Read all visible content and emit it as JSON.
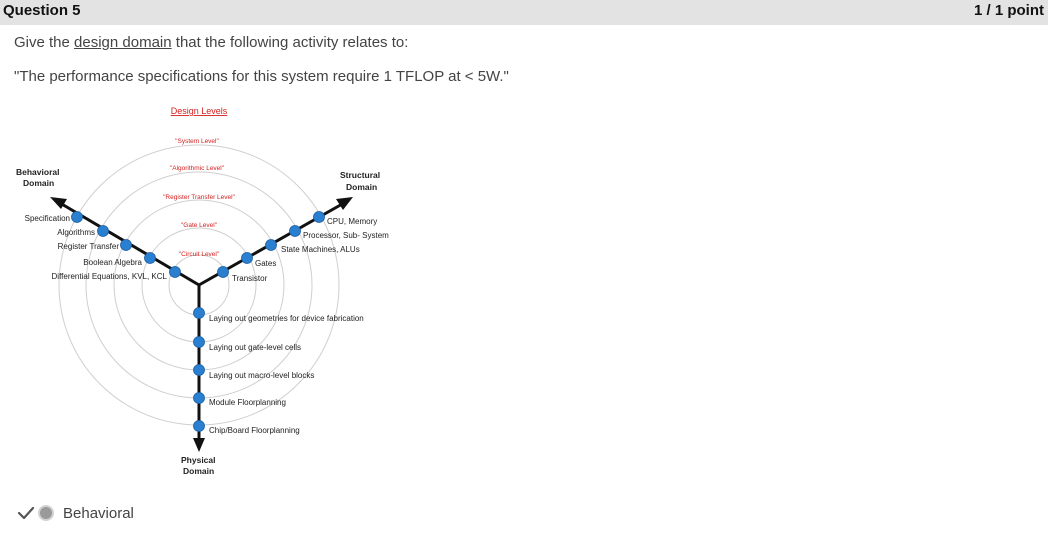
{
  "question": {
    "title": "Question 5",
    "score": "1 / 1 point",
    "prompt_before": "Give the ",
    "prompt_link": "design domain",
    "prompt_after": " that the following activity relates to:",
    "statement": "\"The performance specifications for this system require 1 TFLOP at < 5W.\""
  },
  "diagram": {
    "title": "Design Levels",
    "levels": [
      "\"System Level\"",
      "\"Algorithmic Level\"",
      "\"Register Transfer Level\"",
      "\"Gate Level\"",
      "\"Circuit Level\""
    ],
    "behavioral_domain": [
      "Behavioral",
      "Domain"
    ],
    "structural_domain": [
      "Structural",
      "Domain"
    ],
    "physical_domain": [
      "Physical",
      "Domain"
    ],
    "behavioral_items": [
      "Specification",
      "Algorithms",
      "Register Transfer",
      "Boolean Algebra",
      "Differential Equations, KVL, KCL"
    ],
    "structural_items": [
      "CPU, Memory",
      "Processor, Sub- System",
      "State Machines, ALUs",
      "Gates",
      "Transistor"
    ],
    "physical_items": [
      "Laying out geometries for device fabrication",
      "Laying out gate-level cells",
      "Laying out macro-level blocks",
      "Module Floorplanning",
      "Chip/Board Floorplanning"
    ],
    "colors": {
      "level_text": "#d42020",
      "node": "#2a7fd0",
      "axis": "#111111",
      "circle": "#cfcfcf"
    }
  },
  "answer": {
    "label": "Behavioral",
    "status": "correct"
  }
}
